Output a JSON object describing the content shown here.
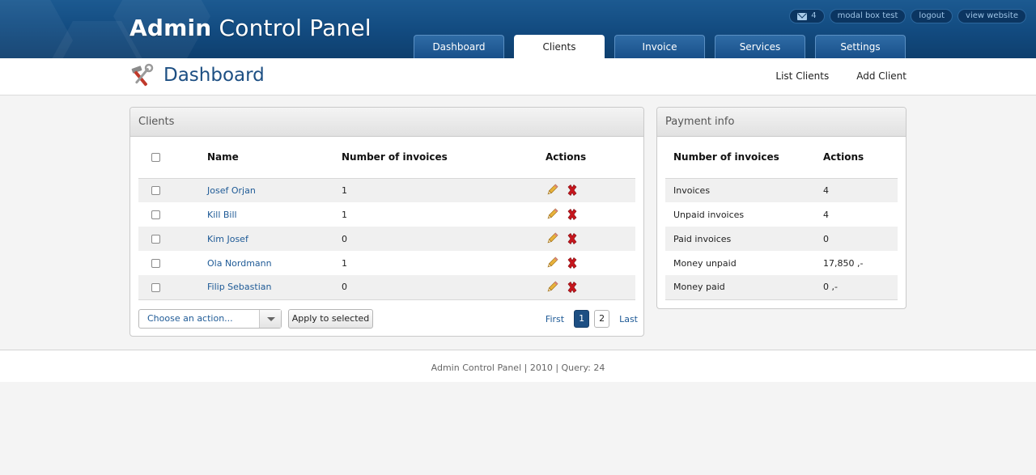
{
  "header": {
    "brand_bold": "Admin",
    "brand_rest": "Control Panel",
    "message_count": "4",
    "links": [
      "modal box test",
      "logout",
      "view website"
    ],
    "tabs": [
      "Dashboard",
      "Clients",
      "Invoice",
      "Services",
      "Settings"
    ],
    "active_tab": "Clients"
  },
  "subheader": {
    "title": "Dashboard",
    "links": [
      "List Clients",
      "Add Client"
    ]
  },
  "clients_panel": {
    "title": "Clients",
    "columns": [
      "Name",
      "Number of invoices",
      "Actions"
    ],
    "rows": [
      {
        "name": "Josef Orjan",
        "invoices": "1"
      },
      {
        "name": "Kill Bill",
        "invoices": "1"
      },
      {
        "name": "Kim Josef",
        "invoices": "0"
      },
      {
        "name": "Ola Nordmann",
        "invoices": "1"
      },
      {
        "name": "Filip Sebastian",
        "invoices": "0"
      }
    ],
    "bulk_select_placeholder": "Choose an action...",
    "apply_label": "Apply to selected",
    "pager": {
      "first": "First",
      "pages": [
        "1",
        "2"
      ],
      "current": "1",
      "last": "Last"
    }
  },
  "payment_panel": {
    "title": "Payment info",
    "columns": [
      "Number of invoices",
      "Actions"
    ],
    "rows": [
      {
        "label": "Invoices",
        "value": "4"
      },
      {
        "label": "Unpaid invoices",
        "value": "4"
      },
      {
        "label": "Paid invoices",
        "value": "0"
      },
      {
        "label": "Money unpaid",
        "value": "17,850 ,-"
      },
      {
        "label": "Money paid",
        "value": "0 ,-"
      }
    ]
  },
  "footer": {
    "text": "Admin Control Panel | 2010 | Query: 24"
  },
  "colors": {
    "header_blue": "#124a7f",
    "link_blue": "#1e5a96",
    "title_blue": "#1d4f83",
    "delete_red": "#c8161d"
  },
  "icons": {
    "messages": "envelope-icon",
    "edit": "pencil-icon",
    "delete": "delete-x-icon",
    "page": "tools-icon"
  }
}
